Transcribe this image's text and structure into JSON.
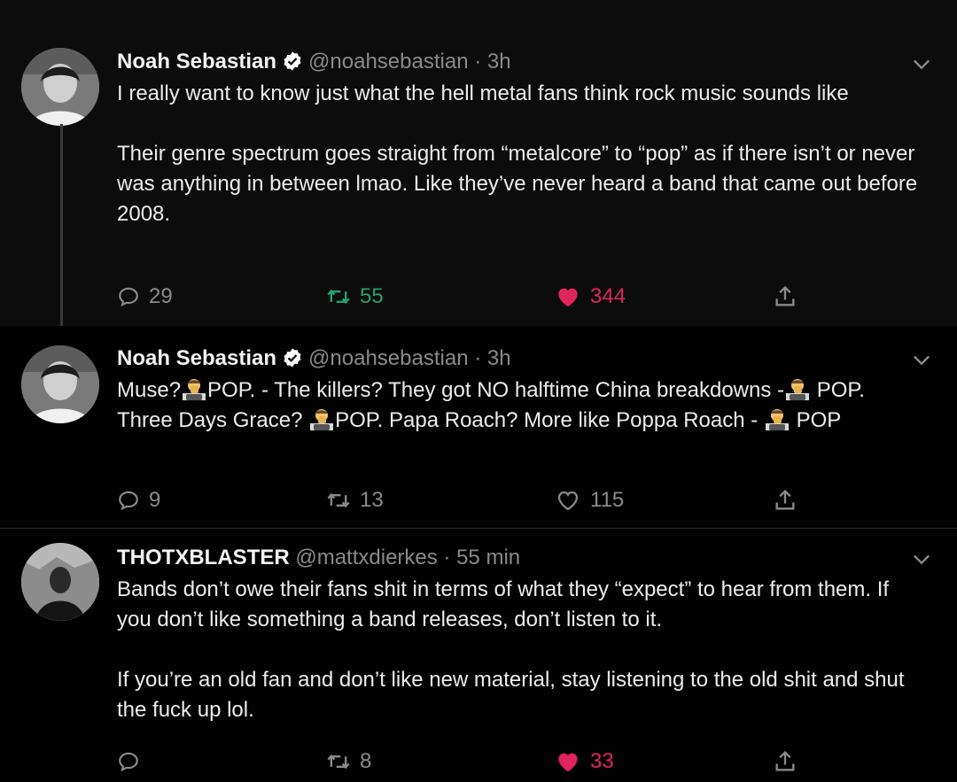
{
  "tweets": [
    {
      "name": "Noah Sebastian",
      "handle": "@noahsebastian",
      "time": "· 3h",
      "paragraphs": [
        "I really want to know just what the hell metal fans think rock music sounds like",
        "Their genre spectrum goes straight from “metalcore” to “pop” as if there isn’t or never was anything in between lmao. Like they’ve never heard a band that came out before 2008."
      ],
      "replies": "29",
      "retweets": "55",
      "likes": "344",
      "retweeted": true,
      "liked": true
    },
    {
      "name": "Noah Sebastian",
      "handle": "@noahsebastian",
      "time": "· 3h",
      "segments": [
        "Muse?",
        "POP.  - The killers? They got NO halftime China breakdowns -",
        "POP. Three Days Grace? ",
        "POP. Papa Roach? More like Poppa Roach - ",
        "POP"
      ],
      "replies": "9",
      "retweets": "13",
      "likes": "115",
      "retweeted": false,
      "liked": false
    },
    {
      "name": "THOTXBLASTER",
      "handle": "@mattxdierkes",
      "time": "· 55 min",
      "paragraphs": [
        "Bands don’t owe their fans shit in terms of what they “expect” to hear from them. If you don’t like something a band releases, don’t listen to it.",
        "If you’re an old fan and don’t like new material, stay listening to the old shit and shut the fuck up lol."
      ],
      "replies": "",
      "retweets": "8",
      "likes": "33",
      "retweeted": false,
      "liked": true
    }
  ],
  "icons": {
    "reply": "speech-bubble-icon",
    "retweet": "retweet-arrows-icon",
    "like": "heart-icon",
    "share": "share-upload-icon",
    "verified": "verified-badge-icon",
    "more": "chevron-down-icon",
    "emoji": "man-facepalming-emoji"
  },
  "colors": {
    "background": "#000000",
    "text": "#e8e8e8",
    "muted": "#8a8a8a",
    "verified": "#ffffff",
    "retweet_active": "#25a36f",
    "like_active": "#e0245e"
  }
}
